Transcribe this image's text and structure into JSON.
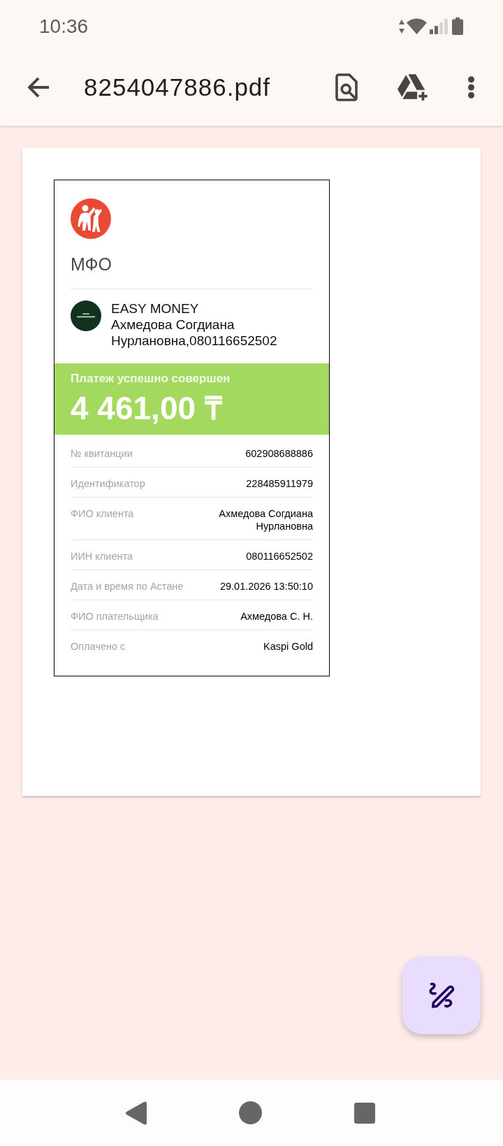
{
  "status_bar": {
    "time": "10:36"
  },
  "app_bar": {
    "title": "8254047886.pdf"
  },
  "receipt": {
    "heading": "МФО",
    "merchant": {
      "name": "EASY MONEY",
      "client": "Ахмедова Согдиана Нурлановна,080116652502"
    },
    "status": "Платеж успешно совершен",
    "amount": "4 461,00 ₸",
    "rows": [
      {
        "label": "№ квитанции",
        "value": "602908688886"
      },
      {
        "label": "Идентификатор",
        "value": "228485911979"
      },
      {
        "label": "ФИО клиента",
        "value": "Ахмедова Согдиана Нурлановна"
      },
      {
        "label": "ИИН клиента",
        "value": "080116652502"
      },
      {
        "label": "Дата и время по Астане",
        "value": "29.01.2026 13:50:10"
      },
      {
        "label": "ФИО плательщика",
        "value": "Ахмедова С. Н."
      },
      {
        "label": "Оплачено с",
        "value": "Kaspi Gold"
      }
    ]
  }
}
